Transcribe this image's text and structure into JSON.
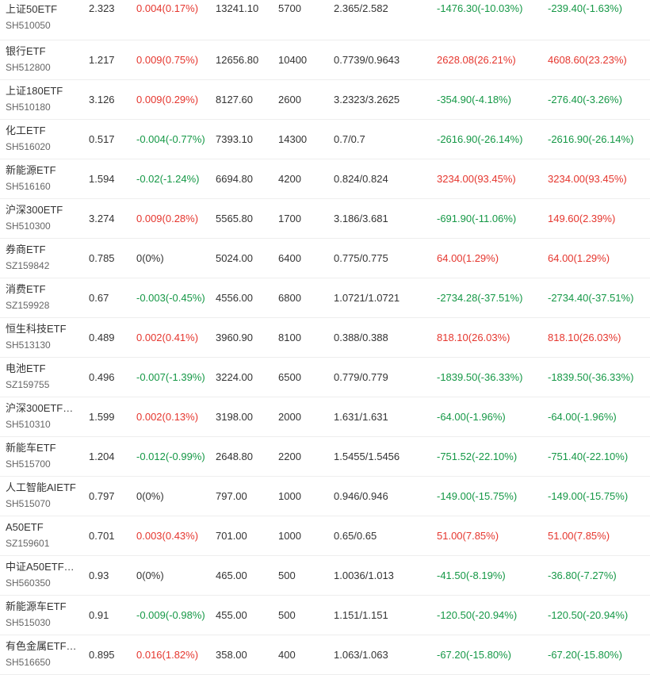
{
  "colors": {
    "up": "#e5362e",
    "down": "#159846",
    "flat": "#333333"
  },
  "rows": [
    {
      "name": "上证50ETF",
      "code": "SH510050",
      "price": "2.323",
      "change": "0.004(0.17%)",
      "change_dir": "up",
      "market_value": "13241.10",
      "shares": "5700",
      "cost": "2.365/2.582",
      "pnl": "-1476.30(-10.03%)",
      "pnl_dir": "down",
      "pnl2": "-239.40(-1.63%)",
      "pnl2_dir": "down"
    },
    {
      "name": "银行ETF",
      "code": "SH512800",
      "price": "1.217",
      "change": "0.009(0.75%)",
      "change_dir": "up",
      "market_value": "12656.80",
      "shares": "10400",
      "cost": "0.7739/0.9643",
      "pnl": "2628.08(26.21%)",
      "pnl_dir": "up",
      "pnl2": "4608.60(23.23%)",
      "pnl2_dir": "up"
    },
    {
      "name": "上证180ETF",
      "code": "SH510180",
      "price": "3.126",
      "change": "0.009(0.29%)",
      "change_dir": "up",
      "market_value": "8127.60",
      "shares": "2600",
      "cost": "3.2323/3.2625",
      "pnl": "-354.90(-4.18%)",
      "pnl_dir": "down",
      "pnl2": "-276.40(-3.26%)",
      "pnl2_dir": "down"
    },
    {
      "name": "化工ETF",
      "code": "SH516020",
      "price": "0.517",
      "change": "-0.004(-0.77%)",
      "change_dir": "down",
      "market_value": "7393.10",
      "shares": "14300",
      "cost": "0.7/0.7",
      "pnl": "-2616.90(-26.14%)",
      "pnl_dir": "down",
      "pnl2": "-2616.90(-26.14%)",
      "pnl2_dir": "down"
    },
    {
      "name": "新能源ETF",
      "code": "SH516160",
      "price": "1.594",
      "change": "-0.02(-1.24%)",
      "change_dir": "down",
      "market_value": "6694.80",
      "shares": "4200",
      "cost": "0.824/0.824",
      "pnl": "3234.00(93.45%)",
      "pnl_dir": "up",
      "pnl2": "3234.00(93.45%)",
      "pnl2_dir": "up"
    },
    {
      "name": "沪深300ETF",
      "code": "SH510300",
      "price": "3.274",
      "change": "0.009(0.28%)",
      "change_dir": "up",
      "market_value": "5565.80",
      "shares": "1700",
      "cost": "3.186/3.681",
      "pnl": "-691.90(-11.06%)",
      "pnl_dir": "down",
      "pnl2": "149.60(2.39%)",
      "pnl2_dir": "up"
    },
    {
      "name": "券商ETF",
      "code": "SZ159842",
      "price": "0.785",
      "change": "0(0%)",
      "change_dir": "flat",
      "market_value": "5024.00",
      "shares": "6400",
      "cost": "0.775/0.775",
      "pnl": "64.00(1.29%)",
      "pnl_dir": "up",
      "pnl2": "64.00(1.29%)",
      "pnl2_dir": "up"
    },
    {
      "name": "消费ETF",
      "code": "SZ159928",
      "price": "0.67",
      "change": "-0.003(-0.45%)",
      "change_dir": "down",
      "market_value": "4556.00",
      "shares": "6800",
      "cost": "1.0721/1.0721",
      "pnl": "-2734.28(-37.51%)",
      "pnl_dir": "down",
      "pnl2": "-2734.40(-37.51%)",
      "pnl2_dir": "down"
    },
    {
      "name": "恒生科技ETF",
      "code": "SH513130",
      "price": "0.489",
      "change": "0.002(0.41%)",
      "change_dir": "up",
      "market_value": "3960.90",
      "shares": "8100",
      "cost": "0.388/0.388",
      "pnl": "818.10(26.03%)",
      "pnl_dir": "up",
      "pnl2": "818.10(26.03%)",
      "pnl2_dir": "up"
    },
    {
      "name": "电池ETF",
      "code": "SZ159755",
      "price": "0.496",
      "change": "-0.007(-1.39%)",
      "change_dir": "down",
      "market_value": "3224.00",
      "shares": "6500",
      "cost": "0.779/0.779",
      "pnl": "-1839.50(-36.33%)",
      "pnl_dir": "down",
      "pnl2": "-1839.50(-36.33%)",
      "pnl2_dir": "down"
    },
    {
      "name": "沪深300ETF…",
      "code": "SH510310",
      "price": "1.599",
      "change": "0.002(0.13%)",
      "change_dir": "up",
      "market_value": "3198.00",
      "shares": "2000",
      "cost": "1.631/1.631",
      "pnl": "-64.00(-1.96%)",
      "pnl_dir": "down",
      "pnl2": "-64.00(-1.96%)",
      "pnl2_dir": "down"
    },
    {
      "name": "新能车ETF",
      "code": "SH515700",
      "price": "1.204",
      "change": "-0.012(-0.99%)",
      "change_dir": "down",
      "market_value": "2648.80",
      "shares": "2200",
      "cost": "1.5455/1.5456",
      "pnl": "-751.52(-22.10%)",
      "pnl_dir": "down",
      "pnl2": "-751.40(-22.10%)",
      "pnl2_dir": "down"
    },
    {
      "name": "人工智能AIETF",
      "code": "SH515070",
      "price": "0.797",
      "change": "0(0%)",
      "change_dir": "flat",
      "market_value": "797.00",
      "shares": "1000",
      "cost": "0.946/0.946",
      "pnl": "-149.00(-15.75%)",
      "pnl_dir": "down",
      "pnl2": "-149.00(-15.75%)",
      "pnl2_dir": "down"
    },
    {
      "name": "A50ETF",
      "code": "SZ159601",
      "price": "0.701",
      "change": "0.003(0.43%)",
      "change_dir": "up",
      "market_value": "701.00",
      "shares": "1000",
      "cost": "0.65/0.65",
      "pnl": "51.00(7.85%)",
      "pnl_dir": "up",
      "pnl2": "51.00(7.85%)",
      "pnl2_dir": "up"
    },
    {
      "name": "中证A50ETF…",
      "code": "SH560350",
      "price": "0.93",
      "change": "0(0%)",
      "change_dir": "flat",
      "market_value": "465.00",
      "shares": "500",
      "cost": "1.0036/1.013",
      "pnl": "-41.50(-8.19%)",
      "pnl_dir": "down",
      "pnl2": "-36.80(-7.27%)",
      "pnl2_dir": "down"
    },
    {
      "name": "新能源车ETF",
      "code": "SH515030",
      "price": "0.91",
      "change": "-0.009(-0.98%)",
      "change_dir": "down",
      "market_value": "455.00",
      "shares": "500",
      "cost": "1.151/1.151",
      "pnl": "-120.50(-20.94%)",
      "pnl_dir": "down",
      "pnl2": "-120.50(-20.94%)",
      "pnl2_dir": "down"
    },
    {
      "name": "有色金属ETF…",
      "code": "SH516650",
      "price": "0.895",
      "change": "0.016(1.82%)",
      "change_dir": "up",
      "market_value": "358.00",
      "shares": "400",
      "cost": "1.063/1.063",
      "pnl": "-67.20(-15.80%)",
      "pnl_dir": "down",
      "pnl2": "-67.20(-15.80%)",
      "pnl2_dir": "down"
    }
  ]
}
